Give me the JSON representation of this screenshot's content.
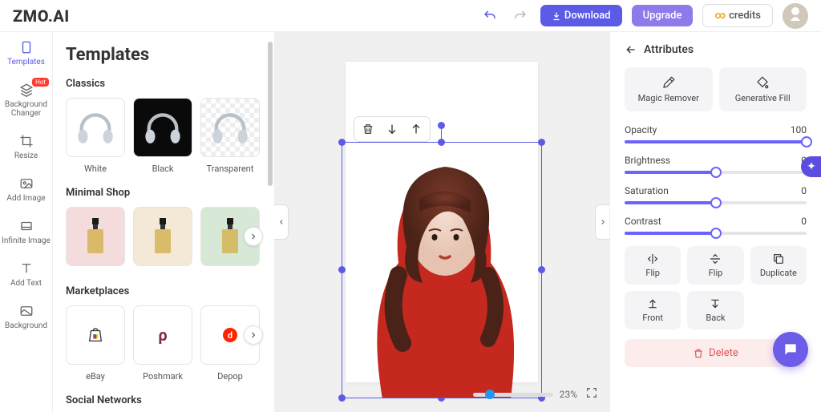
{
  "header": {
    "logo": "ZMO.AI",
    "download": "Download",
    "upgrade": "Upgrade",
    "credits": "credits"
  },
  "nav": {
    "templates": "Templates",
    "bg_changer": "Background Changer",
    "bg_changer_badge": "Hot",
    "resize": "Resize",
    "add_image": "Add Image",
    "infinite_image": "Infinite Image",
    "add_text": "Add Text",
    "background": "Background"
  },
  "templates": {
    "title": "Templates",
    "classics": {
      "title": "Classics",
      "items": [
        "White",
        "Black",
        "Transparent"
      ]
    },
    "minimal_shop": {
      "title": "Minimal Shop"
    },
    "marketplaces": {
      "title": "Marketplaces",
      "items": [
        "eBay",
        "Poshmark",
        "Depop"
      ]
    },
    "social_networks": {
      "title": "Social Networks"
    }
  },
  "canvas": {
    "zoom": "23%"
  },
  "attributes": {
    "title": "Attributes",
    "magic_remover": "Magic Remover",
    "generative_fill": "Generative Fill",
    "opacity": {
      "label": "Opacity",
      "value": "100"
    },
    "brightness": {
      "label": "Brightness",
      "value": "0"
    },
    "saturation": {
      "label": "Saturation",
      "value": "0"
    },
    "contrast": {
      "label": "Contrast",
      "value": "0"
    },
    "flip_h": "Flip",
    "flip_v": "Flip",
    "duplicate": "Duplicate",
    "front": "Front",
    "back": "Back",
    "delete": "Delete"
  }
}
